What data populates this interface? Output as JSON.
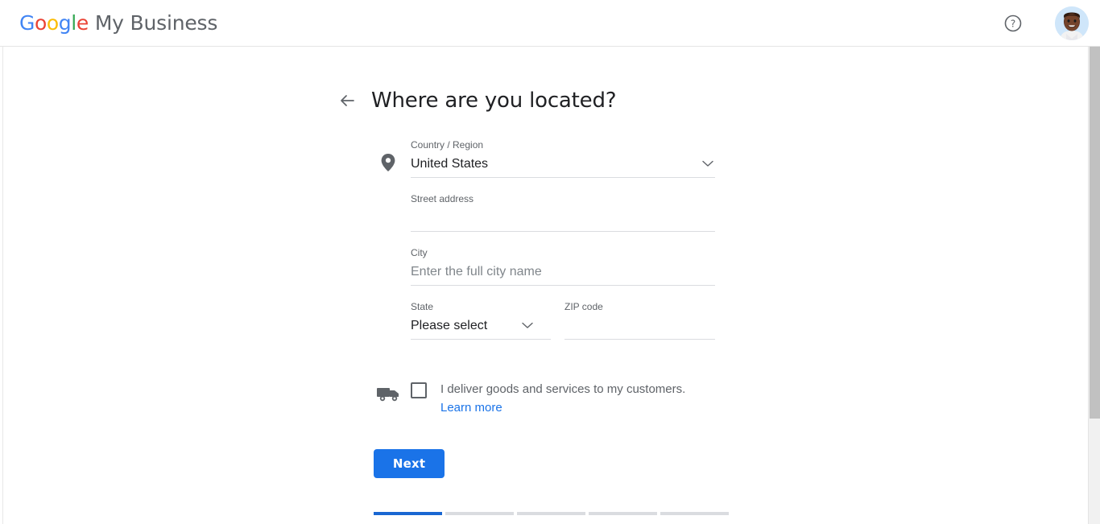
{
  "header": {
    "brand_google": "Google",
    "brand_google_letters": [
      "G",
      "o",
      "o",
      "g",
      "l",
      "e"
    ],
    "brand_product": "My Business",
    "help_icon": "help-circle-icon",
    "avatar_alt": "account-avatar",
    "colors": {
      "blue": "#4285f4",
      "red": "#ea4335",
      "yellow": "#fbbc05",
      "green": "#34a853",
      "product_gray": "#5f6368"
    }
  },
  "page": {
    "back_icon": "arrow-left-icon",
    "title": "Where are you located?",
    "location_icon": "map-pin-icon"
  },
  "form": {
    "country": {
      "label": "Country / Region",
      "value": "United States",
      "chevron": "chevron-down-icon"
    },
    "street": {
      "label": "Street address",
      "value": "",
      "placeholder": ""
    },
    "city": {
      "label": "City",
      "value": "",
      "placeholder": "Enter the full city name"
    },
    "state": {
      "label": "State",
      "value": "Please select",
      "chevron": "chevron-down-icon"
    },
    "zip": {
      "label": "ZIP code",
      "value": "",
      "placeholder": ""
    }
  },
  "delivery": {
    "icon": "delivery-truck-icon",
    "checked": false,
    "text": "I deliver goods and services to my customers.",
    "learn_more": "Learn more"
  },
  "actions": {
    "next_label": "Next"
  },
  "progress": {
    "total_steps": 5,
    "current_step": 1
  },
  "theme": {
    "accent_blue": "#1a73e8",
    "progress_active": "#1967d2",
    "progress_inactive": "#dadce0",
    "text_primary": "#202124",
    "text_secondary": "#5f6368",
    "underline": "#dadce0"
  }
}
